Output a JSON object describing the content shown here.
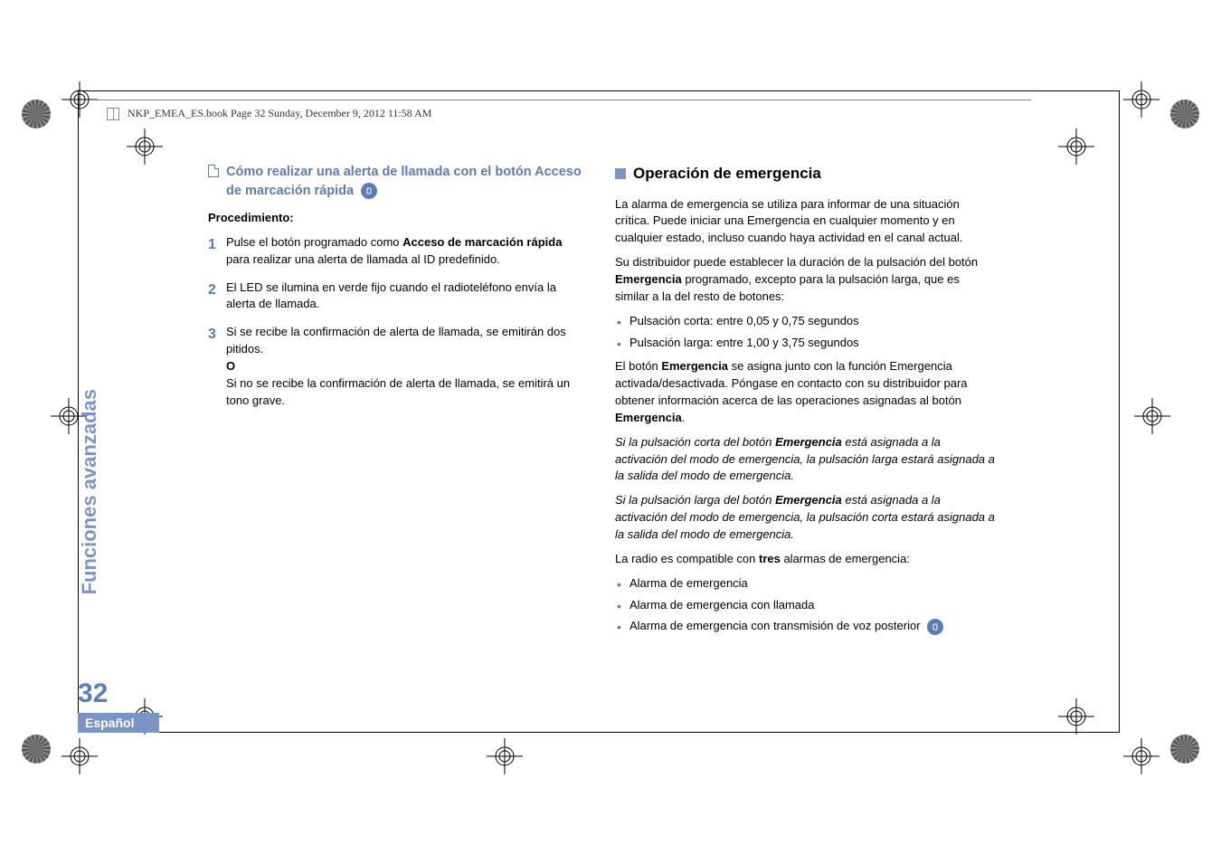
{
  "header": {
    "filename_line": "NKP_EMEA_ES.book  Page 32  Sunday, December 9, 2012  11:58 AM"
  },
  "left_col": {
    "subhead": "Cómo realizar una alerta de llamada con el botón Acceso de marcación rápida",
    "procedimiento_label": "Procedimiento:",
    "step1_a": "Pulse el botón programado como ",
    "step1_b": "Acceso de marcación rápida",
    "step1_c": " para realizar una alerta de llamada al ID predefinido.",
    "step2": "El LED se ilumina en verde fijo cuando el radioteléfono envía la alerta de llamada.",
    "step3_a": "Si se recibe la confirmación de alerta de llamada, se emitirán dos pitidos.",
    "step3_o": "O",
    "step3_b": "Si no se recibe la confirmación de alerta de llamada, se emitirá un tono grave."
  },
  "right_col": {
    "section_title": "Operación de emergencia",
    "p1": "La alarma de emergencia se utiliza para informar de una situación crítica. Puede iniciar una Emergencia en cualquier momento y en cualquier estado, incluso cuando haya actividad en el canal actual.",
    "p2_a": "Su distribuidor puede establecer la duración de la pulsación del botón ",
    "p2_b": "Emergencia",
    "p2_c": " programado, excepto para la pulsación larga, que es similar a la del resto de botones:",
    "b1": "Pulsación corta: entre 0,05 y 0,75 segundos",
    "b2": "Pulsación larga: entre 1,00 y 3,75 segundos",
    "p3_a": "El botón ",
    "p3_b": "Emergencia",
    "p3_c": " se asigna junto con la función Emergencia activada/desactivada. Póngase en contacto con su distribuidor para obtener información acerca de las operaciones asignadas al botón ",
    "p3_d": "Emergencia",
    "p3_e": ".",
    "p4_a": "Si la pulsación corta del botón ",
    "p4_b": "Emergencia",
    "p4_c": " está asignada a la activación del modo de emergencia, la pulsación larga estará asignada a la salida del modo de emergencia.",
    "p5_a": "Si la pulsación larga del botón ",
    "p5_b": "Emergencia",
    "p5_c": " está asignada a la activación del modo de emergencia, la pulsación corta estará asignada a la salida del modo de emergencia.",
    "p6_a": "La radio es compatible con ",
    "p6_b": "tres",
    "p6_c": " alarmas de emergencia:",
    "b3": "Alarma de emergencia",
    "b4": "Alarma de emergencia con llamada",
    "b5": "Alarma de emergencia con transmisión de voz posterior"
  },
  "side": {
    "vertical": "Funciones avanzadas",
    "page_number": "32",
    "language": "Español"
  }
}
